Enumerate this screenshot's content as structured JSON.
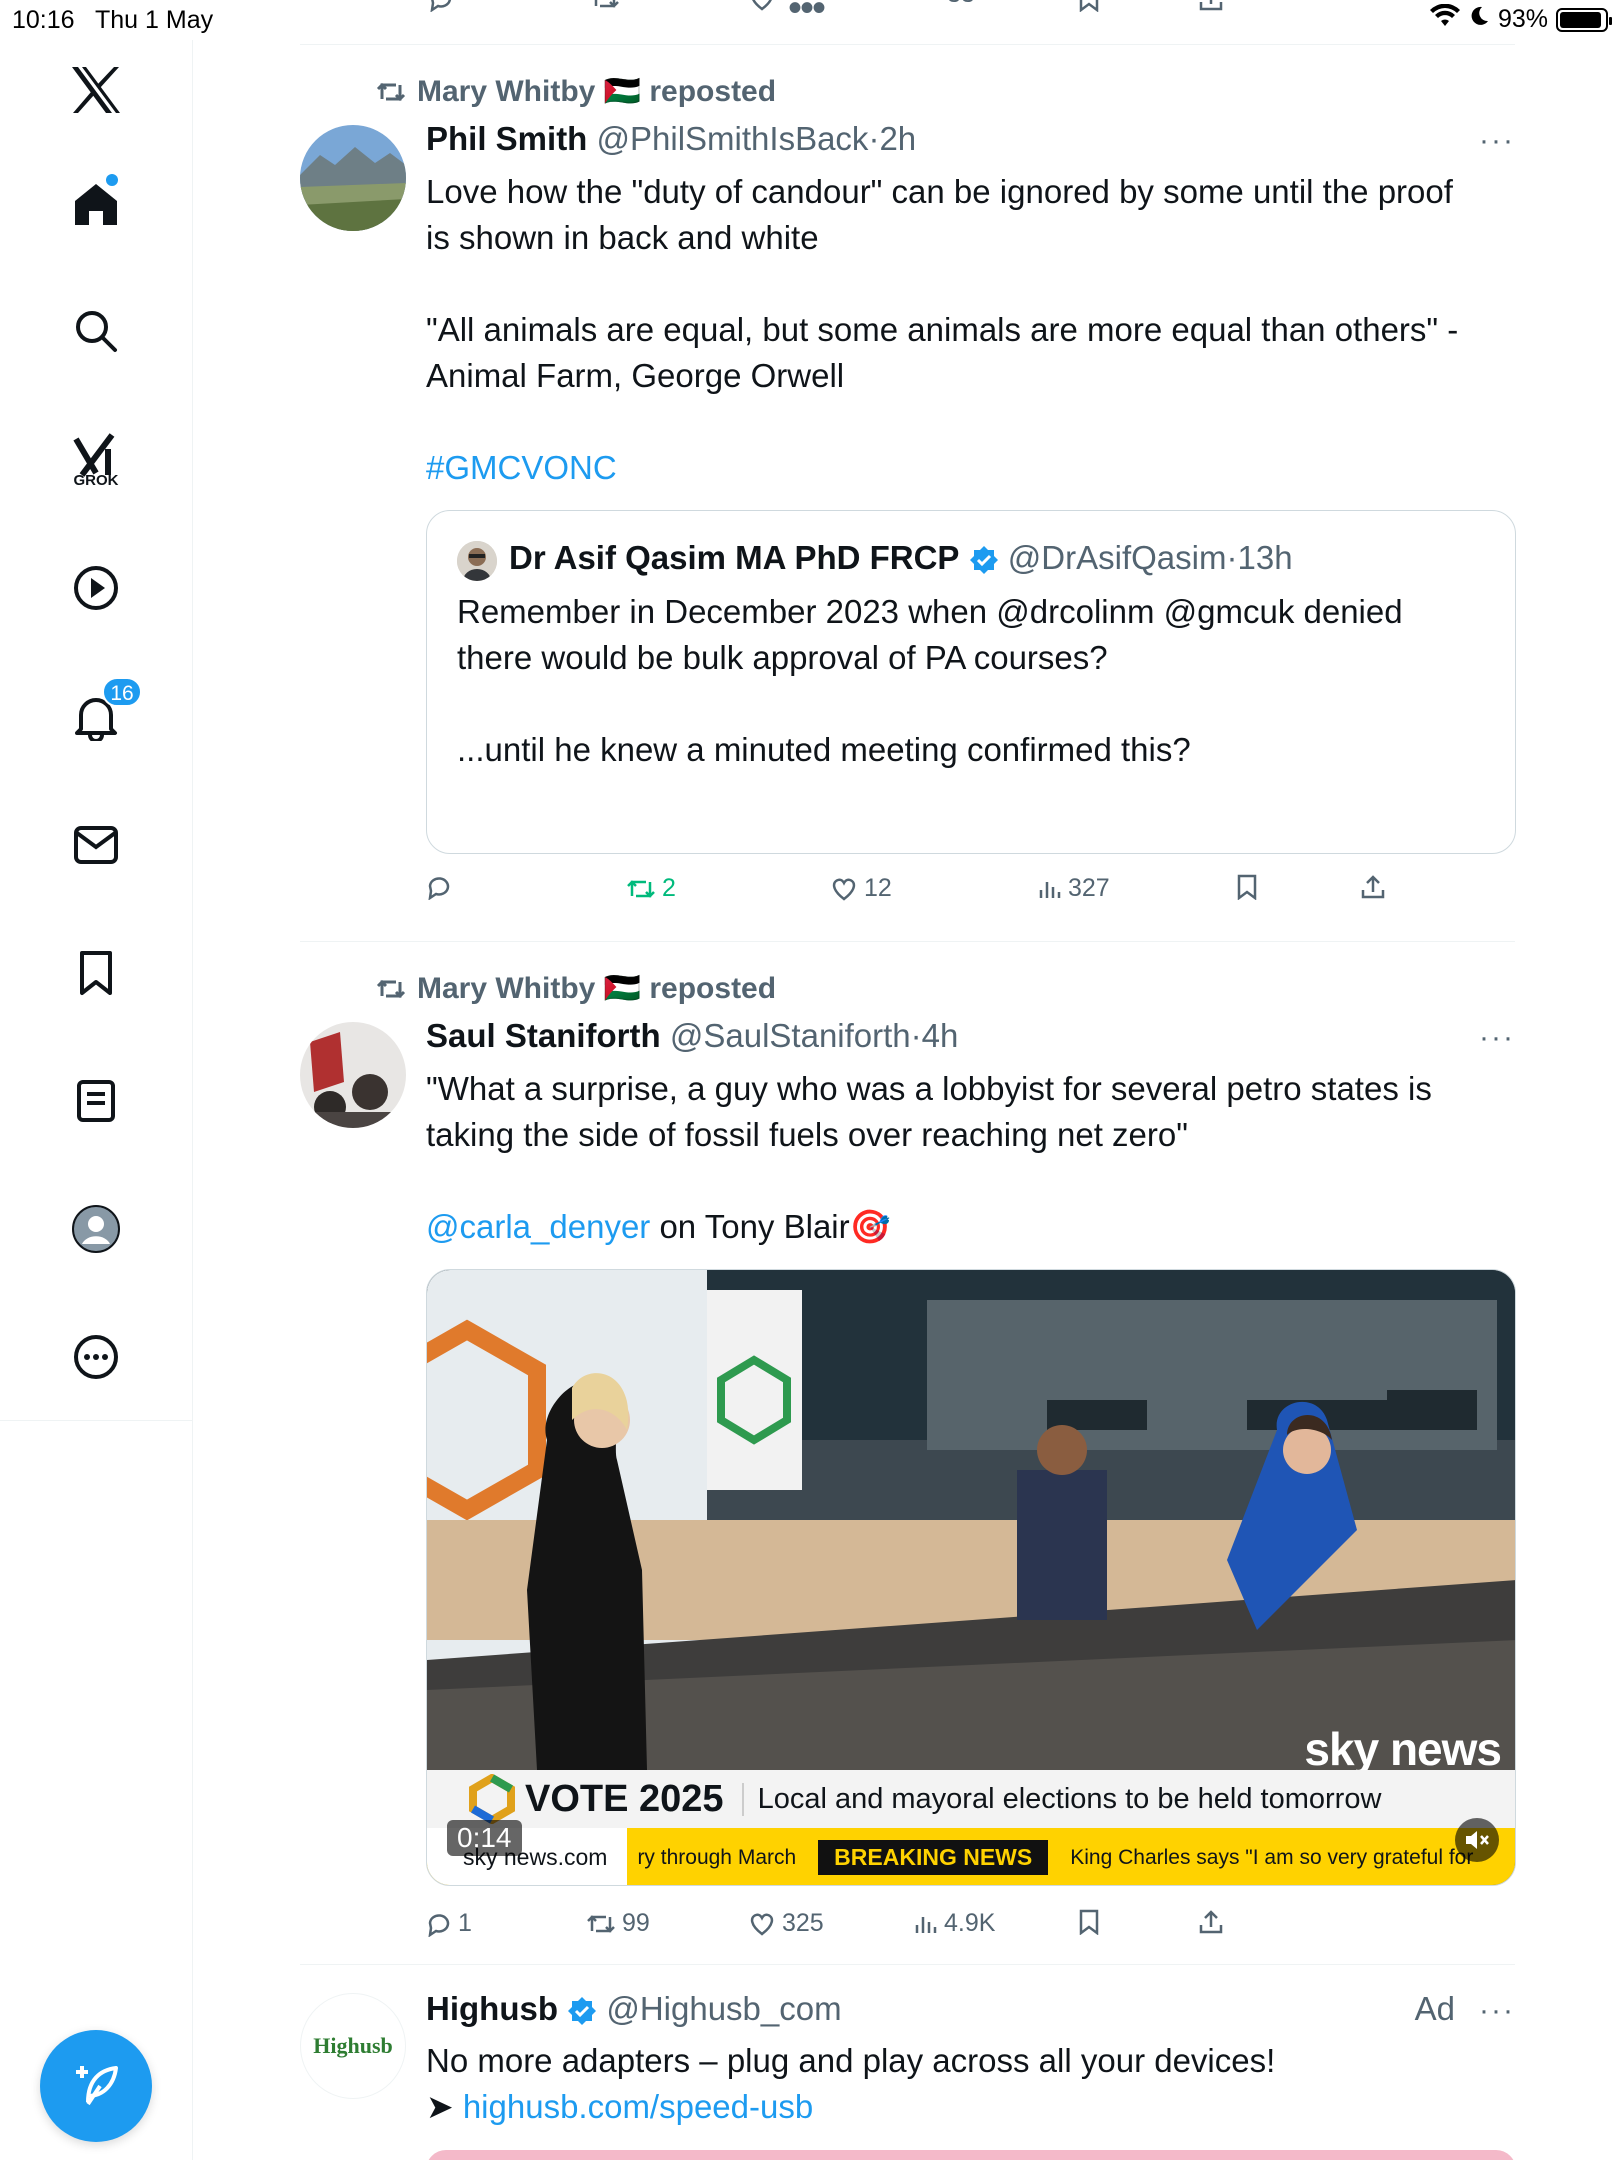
{
  "status_bar": {
    "time": "10:16",
    "date": "Thu 1 May",
    "battery": "93%",
    "battery_level": 0.93
  },
  "sidebar": {
    "items": [
      {
        "name": "x-logo"
      },
      {
        "name": "home"
      },
      {
        "name": "search"
      },
      {
        "name": "grok",
        "label": "GROK"
      },
      {
        "name": "videos"
      },
      {
        "name": "notifications",
        "badge": "16"
      },
      {
        "name": "messages"
      },
      {
        "name": "bookmarks"
      },
      {
        "name": "lists"
      },
      {
        "name": "profile"
      },
      {
        "name": "more"
      }
    ]
  },
  "feed": {
    "top_actions": {
      "views": "33"
    },
    "posts": [
      {
        "reposted_by": "Mary Whitby 🇵🇸 reposted",
        "name": "Phil Smith",
        "handle": "@PhilSmithIsBack",
        "time": "2h",
        "text_lines": [
          "Love how the \"duty of candour\" can be ignored by some until the proof",
          "is shown in back and white",
          "",
          "\"All animals are equal, but some animals are more equal than others\" -",
          "Animal Farm, George Orwell",
          ""
        ],
        "hashtag": "#GMCVONC",
        "quote": {
          "name": "Dr Asif Qasim MA PhD FRCP",
          "handle": "@DrAsifQasim",
          "time": "13h",
          "text_lines": [
            "Remember in December 2023 when @drcolinm @gmcuk denied",
            "there would be bulk approval of PA courses?",
            "",
            "...until he knew a minuted meeting confirmed this?"
          ]
        },
        "stats": {
          "replies": "",
          "reposts": "2",
          "likes": "12",
          "views": "327"
        }
      },
      {
        "reposted_by": "Mary Whitby 🇵🇸 reposted",
        "name": "Saul Staniforth",
        "handle": "@SaulStaniforth",
        "time": "4h",
        "text_lines": [
          "\"What a surprise, a guy who was a lobbyist for several petro states is",
          "taking the side of fossil fuels over reaching net zero\""
        ],
        "mention": "@carla_denyer",
        "mention_rest": " on Tony Blair🎯",
        "video": {
          "duration": "0:14",
          "logo": "sky news",
          "banner_title": "VOTE 2025",
          "banner_text": "Local and mayoral elections to be held tomorrow",
          "ticker_site": "sky news.com",
          "ticker_left": "ry through March",
          "ticker_breaking": "BREAKING NEWS",
          "ticker_right": "King Charles says \"I am so very grateful for"
        },
        "stats": {
          "replies": "1",
          "reposts": "99",
          "likes": "325",
          "views": "4.9K"
        }
      },
      {
        "name": "Highusb",
        "handle": "@Highusb_com",
        "ad_label": "Ad",
        "avatar_text": "Highusb",
        "text": "No more adapters – plug and play across all your devices!",
        "link_prefix": "➤ ",
        "link": "highusb.com/speed-usb"
      }
    ]
  },
  "colors": {
    "accent": "#1d9bf0",
    "repost_green": "#00ba7c",
    "muted": "#536471"
  }
}
